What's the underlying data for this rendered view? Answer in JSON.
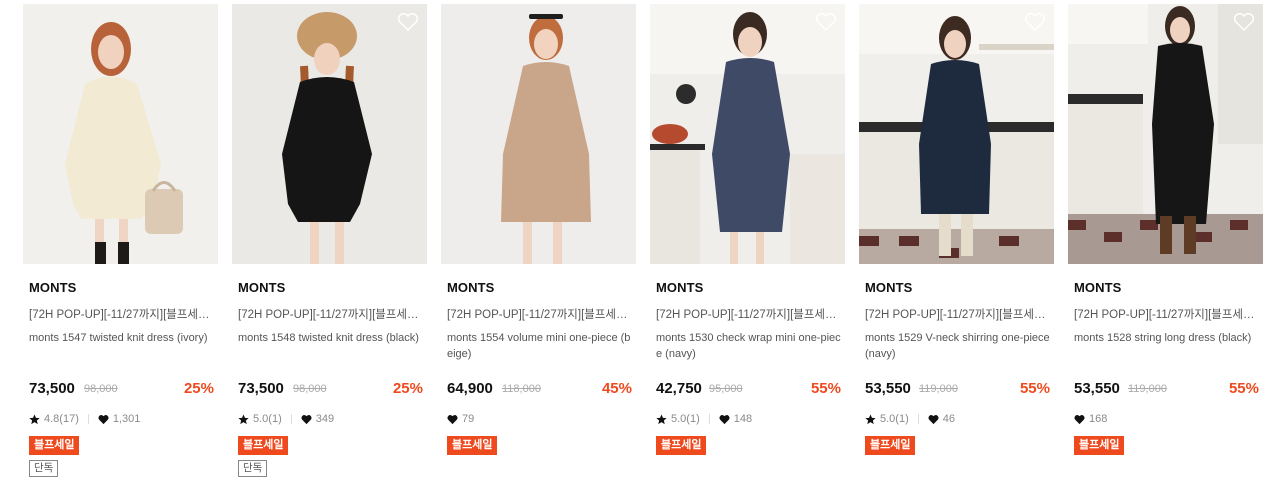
{
  "colors": {
    "discount": "#ef4a1e",
    "sale_badge_bg": "#ef4a1e"
  },
  "icons": {
    "rating": "star-icon",
    "likes": "heart-icon",
    "wishlist": "heart-outline-icon"
  },
  "products": [
    {
      "brand": "MONTS",
      "promo": "[72H POP-UP][-11/27까지][블프세일...",
      "name": "monts 1547 twisted knit dress (ivory)",
      "price": "73,500",
      "original_price": "98,000",
      "discount": "25%",
      "rating": "4.8(17)",
      "likes": "1,301",
      "badges": [
        "블프세일",
        "단독"
      ],
      "image": "woman in ivory cable knit dress holding a fur bag"
    },
    {
      "brand": "MONTS",
      "promo": "[72H POP-UP][-11/27까지][블프세일...",
      "name": "monts 1548 twisted knit dress (black)",
      "price": "73,500",
      "original_price": "98,000",
      "discount": "25%",
      "rating": "5.0(1)",
      "likes": "349",
      "badges": [
        "블프세일",
        "단독"
      ],
      "image": "woman in black knit dress wearing fur hat"
    },
    {
      "brand": "MONTS",
      "promo": "[72H POP-UP][-11/27까지][블프세일...",
      "name": "monts 1554 volume mini one-piece (beige)",
      "price": "64,900",
      "original_price": "118,000",
      "discount": "45%",
      "rating": "",
      "likes": "79",
      "badges": [
        "블프세일"
      ],
      "image": "woman in beige mini dress"
    },
    {
      "brand": "MONTS",
      "promo": "[72H POP-UP][-11/27까지][블프세일...",
      "name": "monts 1530 check wrap mini one-piece (navy)",
      "price": "42,750",
      "original_price": "95,000",
      "discount": "55%",
      "rating": "5.0(1)",
      "likes": "148",
      "badges": [
        "블프세일"
      ],
      "image": "woman in navy check wrap dress in kitchen"
    },
    {
      "brand": "MONTS",
      "promo": "[72H POP-UP][-11/27까지][블프세일...",
      "name": "monts 1529 V-neck shirring one-piece (navy)",
      "price": "53,550",
      "original_price": "119,000",
      "discount": "55%",
      "rating": "5.0(1)",
      "likes": "46",
      "badges": [
        "블프세일"
      ],
      "image": "woman in navy V-neck dress in kitchen"
    },
    {
      "brand": "MONTS",
      "promo": "[72H POP-UP][-11/27까지][블프세일...",
      "name": "monts 1528 string long dress (black)",
      "price": "53,550",
      "original_price": "119,000",
      "discount": "55%",
      "rating": "",
      "likes": "168",
      "badges": [
        "블프세일"
      ],
      "image": "woman in black string long dress in kitchen"
    }
  ]
}
